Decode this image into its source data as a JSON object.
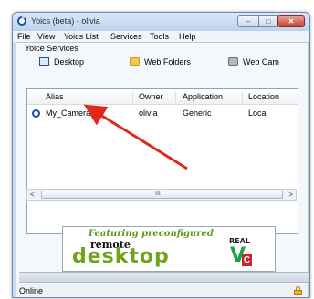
{
  "window": {
    "title": "Yoics (beta) - olivia",
    "minimize": "–",
    "maximize": "□",
    "close": "✕"
  },
  "menu": [
    "File",
    "View",
    "Yoics List",
    "Services",
    "Tools",
    "Help"
  ],
  "voice_services": {
    "label": "Yoice Services",
    "buttons": [
      {
        "label": "Desktop",
        "icon": "desktop-icon"
      },
      {
        "label": "Web Folders",
        "icon": "folder-icon"
      },
      {
        "label": "Web Cam",
        "icon": "webcam-icon"
      }
    ]
  },
  "table": {
    "columns": [
      "Alias",
      "Owner",
      "Application",
      "Location"
    ],
    "rows": [
      {
        "alias": "My_Camera",
        "owner": "olivia",
        "application": "Generic",
        "location": "Local"
      }
    ]
  },
  "scrollbar": {
    "left": "<",
    "right": ">",
    "grip": "III"
  },
  "banner": {
    "headline": "Featuring preconfigured",
    "line1": "remote",
    "line2": "desktop",
    "brand_top": "REAL",
    "brand_main": "V",
    "brand_sub": "C"
  },
  "status": {
    "text": "Online"
  },
  "colors": {
    "arrow": "#e0291d",
    "window_frame": "#6d8bb0",
    "banner_green": "#6ea31b"
  }
}
